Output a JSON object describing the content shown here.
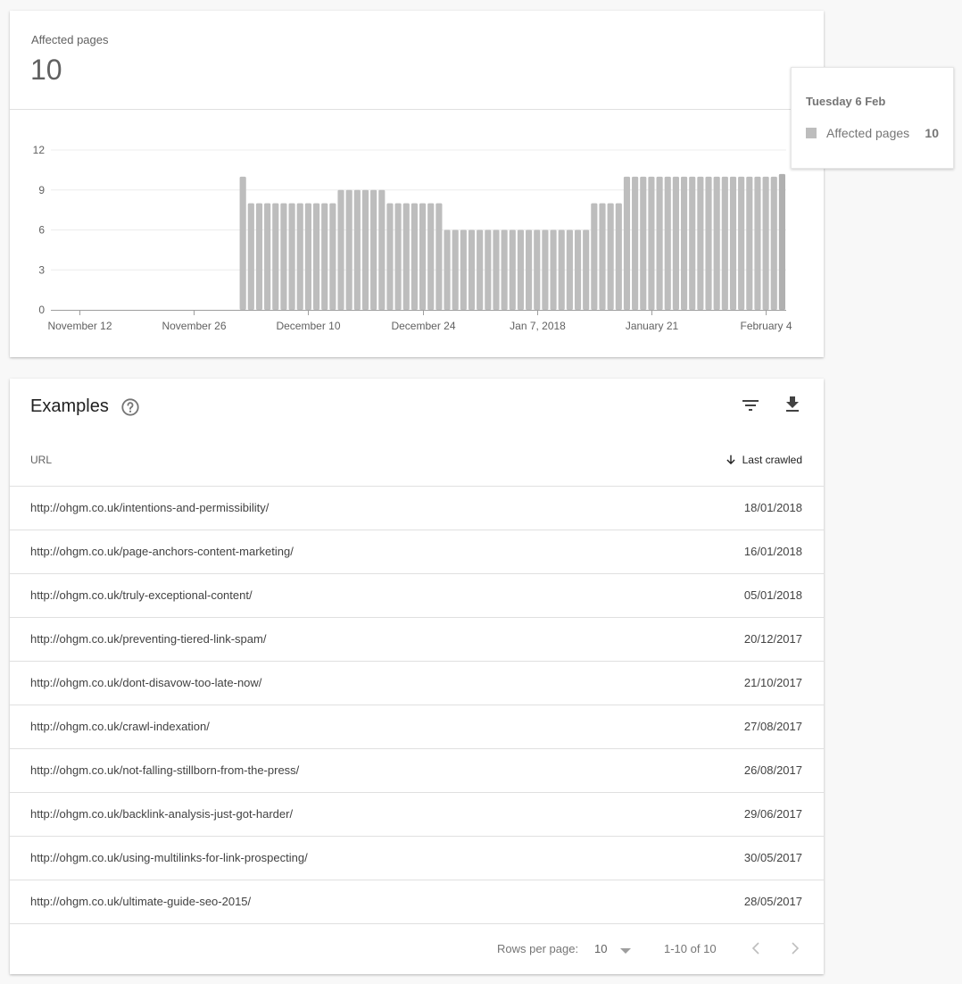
{
  "summary": {
    "metric_label": "Affected pages",
    "metric_value": "10"
  },
  "tooltip": {
    "date": "Tuesday 6 Feb",
    "series_label": "Affected pages",
    "value": "10"
  },
  "colors": {
    "bar": "#bdbdbd",
    "bar_hover": "#b0b0b0",
    "grid": "#ececec",
    "axis": "#9e9e9e"
  },
  "chart_data": {
    "type": "bar",
    "title": "",
    "xlabel": "",
    "ylabel": "",
    "series_name": "Affected pages",
    "ylim": [
      0,
      12
    ],
    "yticks": [
      0,
      3,
      6,
      9,
      12
    ],
    "grid": true,
    "legend": "none",
    "start_date": "2017-11-09",
    "end_date": "2018-02-06",
    "xtick_labels": [
      {
        "date": "2017-11-12",
        "label": "November 12"
      },
      {
        "date": "2017-11-26",
        "label": "November 26"
      },
      {
        "date": "2017-12-10",
        "label": "December 10"
      },
      {
        "date": "2017-12-24",
        "label": "December 24"
      },
      {
        "date": "2018-01-07",
        "label": "Jan 7, 2018"
      },
      {
        "date": "2018-01-21",
        "label": "January 21"
      },
      {
        "date": "2018-02-04",
        "label": "February 4"
      }
    ],
    "values": [
      0,
      0,
      0,
      0,
      0,
      0,
      0,
      0,
      0,
      0,
      0,
      0,
      0,
      0,
      0,
      0,
      0,
      0,
      0,
      0,
      0,
      0,
      0,
      10,
      8,
      8,
      8,
      8,
      8,
      8,
      8,
      8,
      8,
      8,
      8,
      9,
      9,
      9,
      9,
      9,
      9,
      8,
      8,
      8,
      8,
      8,
      8,
      8,
      6,
      6,
      6,
      6,
      6,
      6,
      6,
      6,
      6,
      6,
      6,
      6,
      6,
      6,
      6,
      6,
      6,
      6,
      8,
      8,
      8,
      8,
      10,
      10,
      10,
      10,
      10,
      10,
      10,
      10,
      10,
      10,
      10,
      10,
      10,
      10,
      10,
      10,
      10,
      10,
      10,
      10
    ],
    "highlighted_index": 89
  },
  "examples": {
    "title": "Examples",
    "help_icon": "help-circle-icon",
    "filter_icon": "filter-icon",
    "download_icon": "download-icon",
    "columns": {
      "url": "URL",
      "last_crawled": "Last crawled",
      "sort_icon": "arrow-down-icon"
    },
    "rows": [
      {
        "url": "http://ohgm.co.uk/intentions-and-permissibility/",
        "date": "18/01/2018"
      },
      {
        "url": "http://ohgm.co.uk/page-anchors-content-marketing/",
        "date": "16/01/2018"
      },
      {
        "url": "http://ohgm.co.uk/truly-exceptional-content/",
        "date": "05/01/2018"
      },
      {
        "url": "http://ohgm.co.uk/preventing-tiered-link-spam/",
        "date": "20/12/2017"
      },
      {
        "url": "http://ohgm.co.uk/dont-disavow-too-late-now/",
        "date": "21/10/2017"
      },
      {
        "url": "http://ohgm.co.uk/crawl-indexation/",
        "date": "27/08/2017"
      },
      {
        "url": "http://ohgm.co.uk/not-falling-stillborn-from-the-press/",
        "date": "26/08/2017"
      },
      {
        "url": "http://ohgm.co.uk/backlink-analysis-just-got-harder/",
        "date": "29/06/2017"
      },
      {
        "url": "http://ohgm.co.uk/using-multilinks-for-link-prospecting/",
        "date": "30/05/2017"
      },
      {
        "url": "http://ohgm.co.uk/ultimate-guide-seo-2015/",
        "date": "28/05/2017"
      }
    ],
    "footer": {
      "rows_per_page_label": "Rows per page:",
      "rows_per_page_value": "10",
      "range": "1-10 of 10",
      "prev_icon": "chevron-left-icon",
      "next_icon": "chevron-right-icon"
    }
  }
}
